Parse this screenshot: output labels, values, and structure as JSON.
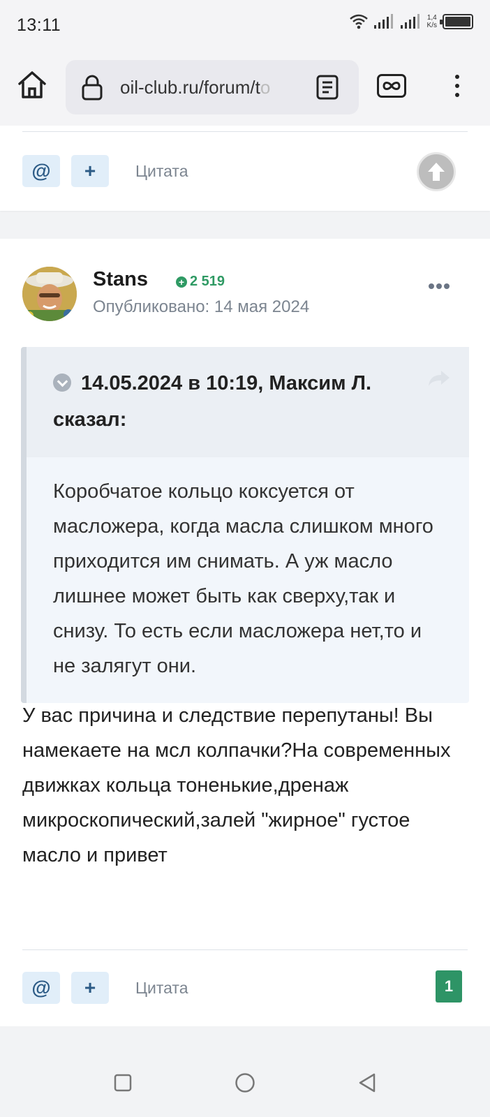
{
  "status_bar": {
    "time": "13:11",
    "speed_top": "1,4",
    "speed_unit": "K/s"
  },
  "browser": {
    "url": "oil-club.ru/forum/t",
    "url_fade": "o"
  },
  "prev_post": {
    "quote_label": "Цитата"
  },
  "post": {
    "author": "Stans",
    "reputation": "2 519",
    "published": "Опубликовано: 14 мая 2024",
    "quote": {
      "header": "14.05.2024 в 10:19, Максим Л. сказал:",
      "text": "Коробчатое кольцо коксуется от масложера, когда масла слишком много приходится им снимать. А уж масло лишнее может быть как сверху,так и снизу. То есть если масложера нет,то и не залягут они."
    },
    "text": "У вас причина и следствие перепутаны! Вы намекаете на мсл колпачки?На современных движках кольца тоненькие,дренаж микроскопический,залей \"жирное\" густое масло и привет",
    "quote_label": "Цитата",
    "reactions_count": "1"
  },
  "colors": {
    "accent": "#2c5b86",
    "reputation": "#2f9a64",
    "badge": "#2e9466"
  }
}
